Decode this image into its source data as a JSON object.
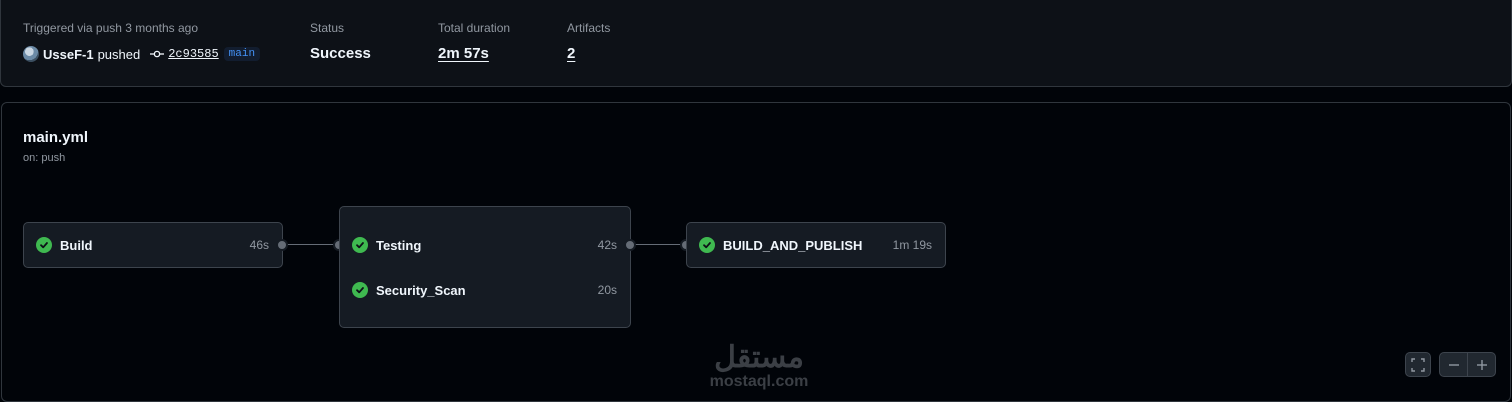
{
  "summary": {
    "trigger": {
      "label": "Triggered via push 3 months ago",
      "actor": "UsseF-1",
      "action": "pushed",
      "commit_sha": "2c93585",
      "branch": "main"
    },
    "status": {
      "label": "Status",
      "value": "Success"
    },
    "duration": {
      "label": "Total duration",
      "value": "2m 57s"
    },
    "artifacts": {
      "label": "Artifacts",
      "value": "2"
    }
  },
  "workflow": {
    "file": "main.yml",
    "trigger": "on: push",
    "jobs": [
      {
        "name": "Build",
        "duration": "46s",
        "status": "success"
      },
      {
        "name": "Testing",
        "duration": "42s",
        "status": "success"
      },
      {
        "name": "Security_Scan",
        "duration": "20s",
        "status": "success"
      },
      {
        "name": "BUILD_AND_PUBLISH",
        "duration": "1m 19s",
        "status": "success"
      }
    ]
  },
  "watermark": {
    "arabic": "مستقل",
    "latin": "mostaql.com"
  },
  "controls": [
    "fullscreen-icon",
    "zoom-out-icon",
    "zoom-in-icon"
  ],
  "colors": {
    "success": "#3fb950",
    "link": "#4493f8",
    "background": "#010409"
  }
}
